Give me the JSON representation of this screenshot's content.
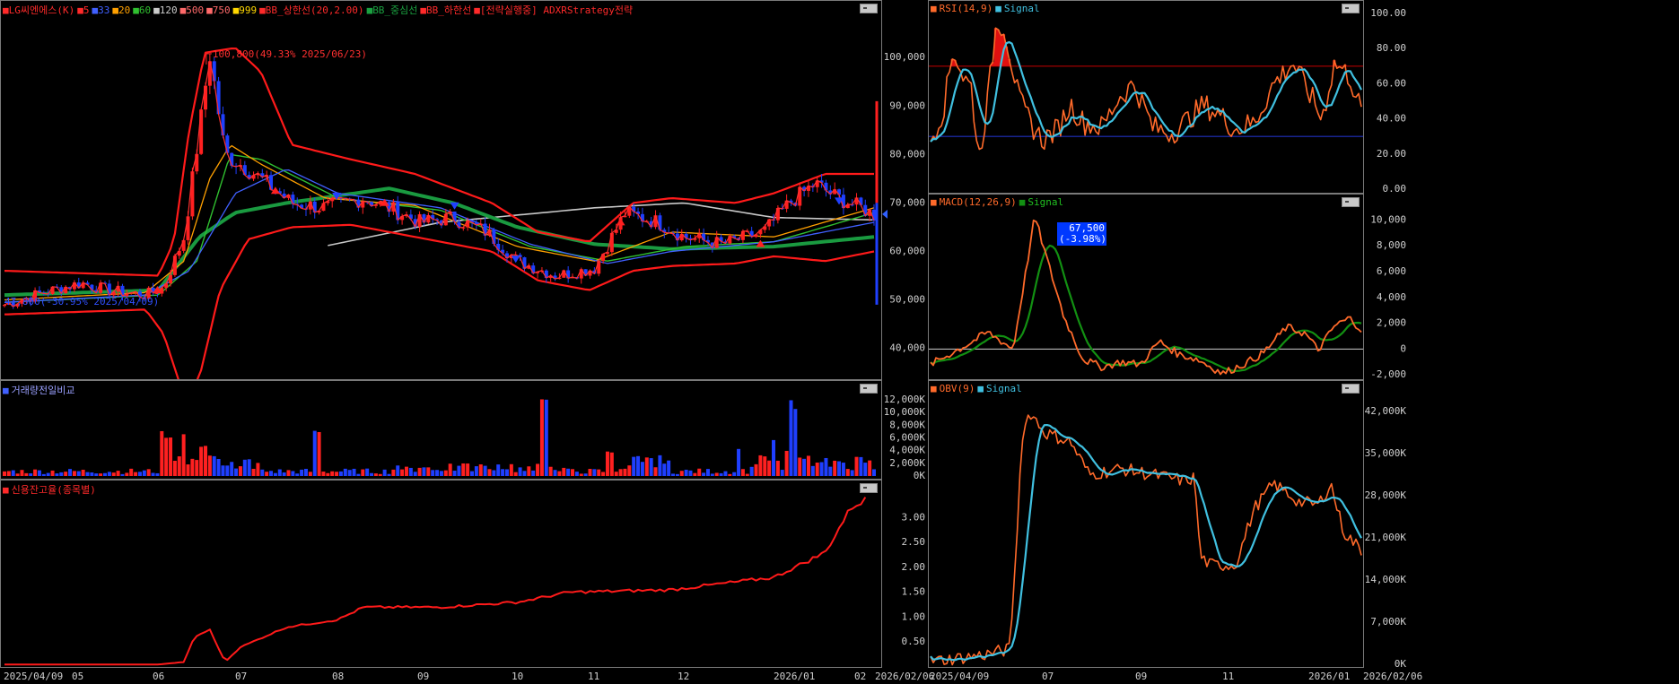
{
  "main_panel": {
    "legend": [
      {
        "text": "LG씨엔에스(K)",
        "color": "#ff2a2a"
      },
      {
        "text": "5",
        "color": "#ff2a2a"
      },
      {
        "text": "33",
        "color": "#4060ff"
      },
      {
        "text": "20",
        "color": "#ffa000"
      },
      {
        "text": "60",
        "color": "#30c030"
      },
      {
        "text": "120",
        "color": "#cccccc"
      },
      {
        "text": "500",
        "color": "#ff6a6a"
      },
      {
        "text": "750",
        "color": "#ff6a6a"
      },
      {
        "text": "999",
        "color": "#ffd700"
      },
      {
        "text": "BB_상한선(20,2.00)",
        "color": "#ff2a2a"
      },
      {
        "text": "BB_중심선",
        "color": "#1aa040"
      },
      {
        "text": "BB_하한선",
        "color": "#ff2a2a"
      },
      {
        "text": "[전략실행중] ADXRStrategy전략",
        "color": "#ff2a2a"
      }
    ],
    "high_annotation": "100,800(49.33% 2025/06/23)",
    "low_annotation": "47,800(-30.95% 2025/04/09)",
    "price_tag_value": "67,500",
    "price_tag_change": "(-3.98%)"
  },
  "volume_panel": {
    "legend": "거래량전일비교"
  },
  "credit_panel": {
    "legend": "신용잔고율(종목별)"
  },
  "rsi_panel": {
    "legend_main": "RSI(14,9)",
    "legend_signal": "Signal"
  },
  "macd_panel": {
    "legend_main": "MACD(12,26,9)",
    "legend_signal": "Signal"
  },
  "obv_panel": {
    "legend_main": "OBV(9)",
    "legend_signal": "Signal"
  },
  "x_axis_left": [
    "2025/04/09",
    "05",
    "06",
    "07",
    "08",
    "09",
    "10",
    "11",
    "12",
    "2026/01",
    "02",
    "2026/02/06"
  ],
  "x_axis_right": [
    "2025/04/09",
    "07",
    "09",
    "11",
    "2026/01",
    "2026/02/06"
  ],
  "colors": {
    "up": "#ff2020",
    "down": "#1f3fff",
    "rsi": "#ff6a2a",
    "rsi_signal": "#40c0e0",
    "macd_signal": "#129012",
    "bb": "#ff1a1a",
    "bb_mid": "#1a9a40"
  },
  "chart_data": [
    {
      "name": "price",
      "type": "line",
      "x": [
        "2025/04/09",
        "2025/05/01",
        "2025/06/01",
        "2025/06/23",
        "2025/07/15",
        "2025/08/01",
        "2025/09/01",
        "2025/10/01",
        "2025/11/01",
        "2025/12/01",
        "2026/01/01",
        "2026/02/06"
      ],
      "series": [
        {
          "name": "LG씨엔에스(K)",
          "values": [
            48000,
            52500,
            53000,
            100800,
            76000,
            70000,
            70000,
            67000,
            58000,
            57000,
            63500,
            67500
          ]
        }
      ],
      "yticks": [
        "40,000",
        "50,000",
        "60,000",
        "70,000",
        "80,000",
        "90,000",
        "100,000"
      ],
      "ylim": [
        34000,
        108000
      ]
    },
    {
      "name": "volume",
      "type": "bar",
      "yticks": [
        "0K",
        "2,000K",
        "4,000K",
        "6,000K",
        "8,000K",
        "10,000K",
        "12,000K"
      ],
      "ylim": [
        0,
        13000
      ]
    },
    {
      "name": "credit_balance",
      "type": "line",
      "yticks": [
        "0.50",
        "1.00",
        "1.50",
        "2.00",
        "2.50",
        "3.00"
      ],
      "ylim": [
        0,
        3.6
      ]
    },
    {
      "name": "rsi",
      "type": "line",
      "series": [
        {
          "name": "RSI(14,9)"
        },
        {
          "name": "Signal"
        }
      ],
      "yticks": [
        "0.00",
        "20.00",
        "40.00",
        "60.00",
        "80.00",
        "100.00"
      ],
      "ylim": [
        0,
        100
      ]
    },
    {
      "name": "macd",
      "type": "line",
      "series": [
        {
          "name": "MACD(12,26,9)"
        },
        {
          "name": "Signal"
        }
      ],
      "yticks": [
        "-2,000",
        "0",
        "2,000",
        "4,000",
        "6,000",
        "8,000",
        "10,000"
      ],
      "ylim": [
        -2200,
        11000
      ]
    },
    {
      "name": "obv",
      "type": "line",
      "series": [
        {
          "name": "OBV(9)"
        },
        {
          "name": "Signal"
        }
      ],
      "yticks": [
        "0K",
        "7,000K",
        "14,000K",
        "21,000K",
        "28,000K",
        "35,000K",
        "42,000K"
      ],
      "ylim": [
        0,
        45000
      ]
    }
  ]
}
